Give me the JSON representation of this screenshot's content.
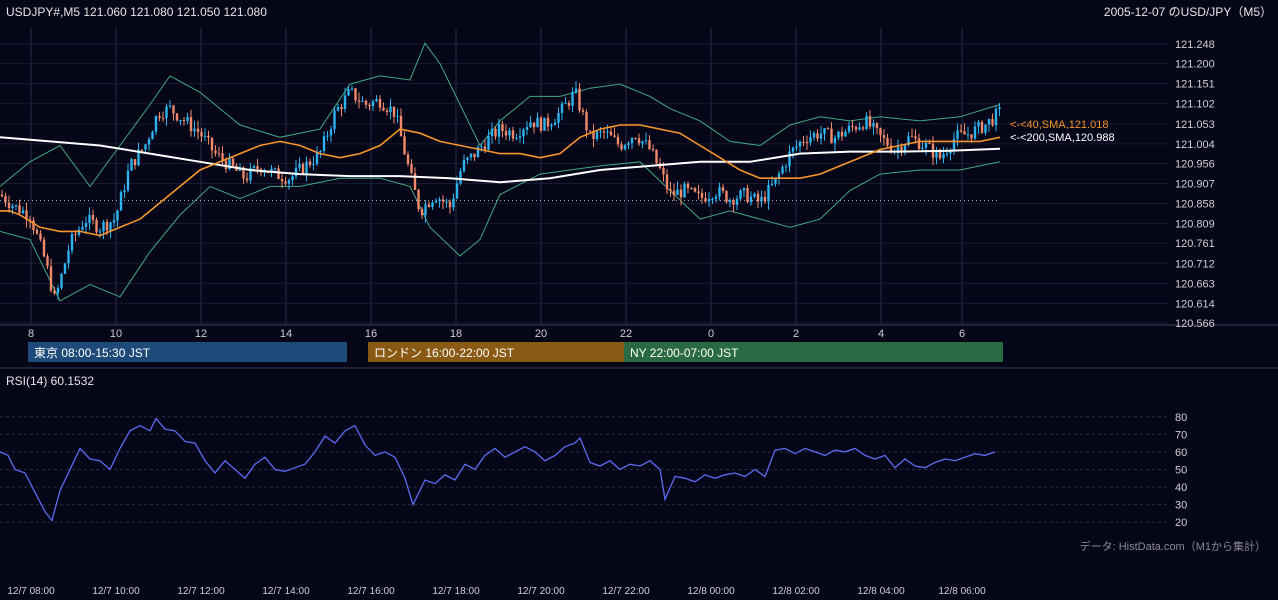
{
  "header": {
    "symbol_line": "USDJPY#,M5 121.060 121.080 121.050 121.080",
    "title": "2005-12-07 のUSD/JPY（M5）"
  },
  "chart_data": [
    {
      "type": "candlestick",
      "name": "price",
      "y_ticks": [
        "121.248",
        "121.200",
        "121.151",
        "121.102",
        "121.053",
        "121.004",
        "120.956",
        "120.907",
        "120.858",
        "120.809",
        "120.761",
        "120.712",
        "120.663",
        "120.614",
        "120.566"
      ],
      "ylim": [
        120.566,
        121.248
      ],
      "x_ticks": [
        "8",
        "10",
        "12",
        "14",
        "16",
        "18",
        "20",
        "22",
        "0",
        "2",
        "4",
        "6"
      ],
      "dotted_level": 120.865,
      "sma40": {
        "label": "<-<40,SMA,121.018",
        "value": 121.018,
        "color": "#f5962d",
        "points": [
          [
            0,
            120.84
          ],
          [
            10,
            120.84
          ],
          [
            20,
            120.83
          ],
          [
            40,
            120.8
          ],
          [
            60,
            120.79
          ],
          [
            80,
            120.79
          ],
          [
            100,
            120.78
          ],
          [
            120,
            120.8
          ],
          [
            140,
            120.82
          ],
          [
            160,
            120.86
          ],
          [
            180,
            120.9
          ],
          [
            200,
            120.94
          ],
          [
            220,
            120.96
          ],
          [
            240,
            120.98
          ],
          [
            260,
            121.0
          ],
          [
            280,
            121.01
          ],
          [
            300,
            121.0
          ],
          [
            320,
            120.98
          ],
          [
            340,
            120.97
          ],
          [
            360,
            120.98
          ],
          [
            380,
            121.0
          ],
          [
            400,
            121.04
          ],
          [
            420,
            121.03
          ],
          [
            440,
            121.01
          ],
          [
            460,
            121.0
          ],
          [
            480,
            120.99
          ],
          [
            500,
            120.98
          ],
          [
            520,
            120.98
          ],
          [
            540,
            120.97
          ],
          [
            560,
            120.98
          ],
          [
            580,
            121.02
          ],
          [
            600,
            121.04
          ],
          [
            620,
            121.05
          ],
          [
            640,
            121.05
          ],
          [
            660,
            121.04
          ],
          [
            680,
            121.03
          ],
          [
            700,
            121.0
          ],
          [
            720,
            120.97
          ],
          [
            740,
            120.94
          ],
          [
            760,
            120.92
          ],
          [
            780,
            120.92
          ],
          [
            800,
            120.92
          ],
          [
            820,
            120.93
          ],
          [
            840,
            120.95
          ],
          [
            860,
            120.97
          ],
          [
            880,
            120.99
          ],
          [
            900,
            121.0
          ],
          [
            920,
            121.01
          ],
          [
            940,
            121.01
          ],
          [
            960,
            121.01
          ],
          [
            980,
            121.01
          ],
          [
            1000,
            121.02
          ]
        ]
      },
      "sma200": {
        "label": "<-<200,SMA,120.988",
        "value": 120.988,
        "color": "#ffffff",
        "points": [
          [
            0,
            121.02
          ],
          [
            50,
            121.01
          ],
          [
            100,
            121.0
          ],
          [
            150,
            120.98
          ],
          [
            200,
            120.96
          ],
          [
            250,
            120.94
          ],
          [
            300,
            120.93
          ],
          [
            350,
            120.925
          ],
          [
            400,
            120.925
          ],
          [
            450,
            120.92
          ],
          [
            500,
            120.91
          ],
          [
            550,
            120.92
          ],
          [
            600,
            120.94
          ],
          [
            650,
            120.95
          ],
          [
            700,
            120.96
          ],
          [
            750,
            120.96
          ],
          [
            800,
            120.98
          ],
          [
            850,
            120.985
          ],
          [
            900,
            120.985
          ],
          [
            950,
            120.987
          ],
          [
            1000,
            120.992
          ]
        ]
      },
      "bollinger": {
        "color": "#4fd19a",
        "upper": [
          [
            0,
            120.9
          ],
          [
            30,
            120.96
          ],
          [
            60,
            121.0
          ],
          [
            90,
            120.9
          ],
          [
            120,
            121.0
          ],
          [
            150,
            121.1
          ],
          [
            170,
            121.17
          ],
          [
            200,
            121.13
          ],
          [
            240,
            121.05
          ],
          [
            280,
            121.02
          ],
          [
            320,
            121.04
          ],
          [
            350,
            121.15
          ],
          [
            380,
            121.17
          ],
          [
            410,
            121.16
          ],
          [
            425,
            121.25
          ],
          [
            440,
            121.2
          ],
          [
            460,
            121.1
          ],
          [
            480,
            121.0
          ],
          [
            500,
            121.06
          ],
          [
            530,
            121.12
          ],
          [
            560,
            121.12
          ],
          [
            590,
            121.14
          ],
          [
            620,
            121.15
          ],
          [
            650,
            121.12
          ],
          [
            670,
            121.09
          ],
          [
            700,
            121.06
          ],
          [
            730,
            121.01
          ],
          [
            760,
            121.0
          ],
          [
            790,
            121.05
          ],
          [
            820,
            121.07
          ],
          [
            850,
            121.06
          ],
          [
            880,
            121.07
          ],
          [
            920,
            121.06
          ],
          [
            960,
            121.07
          ],
          [
            1000,
            121.1
          ]
        ],
        "lower": [
          [
            0,
            120.79
          ],
          [
            30,
            120.77
          ],
          [
            60,
            120.62
          ],
          [
            90,
            120.66
          ],
          [
            120,
            120.63
          ],
          [
            150,
            120.74
          ],
          [
            180,
            120.83
          ],
          [
            210,
            120.9
          ],
          [
            240,
            120.87
          ],
          [
            270,
            120.9
          ],
          [
            300,
            120.9
          ],
          [
            340,
            120.92
          ],
          [
            380,
            120.92
          ],
          [
            410,
            120.9
          ],
          [
            430,
            120.8
          ],
          [
            460,
            120.73
          ],
          [
            480,
            120.77
          ],
          [
            500,
            120.88
          ],
          [
            540,
            120.93
          ],
          [
            570,
            120.94
          ],
          [
            600,
            120.95
          ],
          [
            640,
            120.96
          ],
          [
            670,
            120.89
          ],
          [
            700,
            120.82
          ],
          [
            730,
            120.84
          ],
          [
            760,
            120.82
          ],
          [
            790,
            120.8
          ],
          [
            820,
            120.82
          ],
          [
            850,
            120.89
          ],
          [
            880,
            120.93
          ],
          [
            920,
            120.94
          ],
          [
            960,
            120.94
          ],
          [
            1000,
            120.96
          ]
        ]
      },
      "close_series": [
        [
          0,
          120.88
        ],
        [
          15,
          120.85
        ],
        [
          30,
          120.83
        ],
        [
          45,
          120.72
        ],
        [
          55,
          120.62
        ],
        [
          70,
          120.76
        ],
        [
          85,
          120.82
        ],
        [
          100,
          120.8
        ],
        [
          115,
          120.82
        ],
        [
          130,
          120.95
        ],
        [
          145,
          121.0
        ],
        [
          158,
          121.08
        ],
        [
          170,
          121.09
        ],
        [
          185,
          121.06
        ],
        [
          200,
          121.03
        ],
        [
          215,
          120.98
        ],
        [
          230,
          120.95
        ],
        [
          245,
          120.92
        ],
        [
          260,
          120.95
        ],
        [
          275,
          120.93
        ],
        [
          290,
          120.92
        ],
        [
          305,
          120.95
        ],
        [
          320,
          120.98
        ],
        [
          335,
          121.08
        ],
        [
          350,
          121.13
        ],
        [
          365,
          121.1
        ],
        [
          380,
          121.11
        ],
        [
          395,
          121.08
        ],
        [
          410,
          120.93
        ],
        [
          420,
          120.84
        ],
        [
          435,
          120.88
        ],
        [
          450,
          120.85
        ],
        [
          462,
          120.95
        ],
        [
          475,
          120.98
        ],
        [
          490,
          121.02
        ],
        [
          500,
          121.04
        ],
        [
          515,
          121.03
        ],
        [
          530,
          121.06
        ],
        [
          545,
          121.05
        ],
        [
          560,
          121.08
        ],
        [
          575,
          121.13
        ],
        [
          590,
          121.02
        ],
        [
          605,
          121.03
        ],
        [
          620,
          121.0
        ],
        [
          635,
          121.03
        ],
        [
          650,
          120.99
        ],
        [
          660,
          120.94
        ],
        [
          670,
          120.88
        ],
        [
          685,
          120.89
        ],
        [
          700,
          120.87
        ],
        [
          715,
          120.89
        ],
        [
          730,
          120.87
        ],
        [
          745,
          120.88
        ],
        [
          760,
          120.86
        ],
        [
          775,
          120.91
        ],
        [
          790,
          120.98
        ],
        [
          805,
          121.02
        ],
        [
          820,
          121.03
        ],
        [
          835,
          121.02
        ],
        [
          850,
          121.04
        ],
        [
          865,
          121.06
        ],
        [
          880,
          121.02
        ],
        [
          895,
          120.99
        ],
        [
          910,
          121.02
        ],
        [
          925,
          121.0
        ],
        [
          940,
          120.97
        ],
        [
          955,
          121.02
        ],
        [
          970,
          121.03
        ],
        [
          985,
          121.05
        ],
        [
          1000,
          121.08
        ]
      ]
    },
    {
      "type": "line",
      "name": "RSI(14) 60.1532",
      "color": "#5b6cf0",
      "y_ticks": [
        "80",
        "70",
        "60",
        "50",
        "40",
        "30",
        "20"
      ],
      "ylim": [
        15,
        85
      ],
      "x_ticks": [
        "12/7 08:00",
        "12/7 10:00",
        "12/7 12:00",
        "12/7 14:00",
        "12/7 16:00",
        "12/7 18:00",
        "12/7 20:00",
        "12/7 22:00",
        "12/8 00:00",
        "12/8 02:00",
        "12/8 04:00",
        "12/8 06:00"
      ],
      "values": [
        [
          0,
          60
        ],
        [
          8,
          58
        ],
        [
          15,
          50
        ],
        [
          25,
          48
        ],
        [
          35,
          37
        ],
        [
          45,
          26
        ],
        [
          52,
          21
        ],
        [
          60,
          38
        ],
        [
          70,
          50
        ],
        [
          80,
          62
        ],
        [
          90,
          56
        ],
        [
          100,
          55
        ],
        [
          110,
          50
        ],
        [
          120,
          62
        ],
        [
          130,
          72
        ],
        [
          140,
          75
        ],
        [
          150,
          72
        ],
        [
          156,
          79
        ],
        [
          165,
          73
        ],
        [
          175,
          72
        ],
        [
          185,
          66
        ],
        [
          195,
          65
        ],
        [
          205,
          55
        ],
        [
          215,
          48
        ],
        [
          225,
          55
        ],
        [
          235,
          50
        ],
        [
          245,
          45
        ],
        [
          255,
          53
        ],
        [
          265,
          57
        ],
        [
          275,
          50
        ],
        [
          285,
          49
        ],
        [
          295,
          51
        ],
        [
          305,
          53
        ],
        [
          315,
          60
        ],
        [
          325,
          69
        ],
        [
          335,
          65
        ],
        [
          345,
          72
        ],
        [
          355,
          75
        ],
        [
          365,
          64
        ],
        [
          375,
          58
        ],
        [
          385,
          60
        ],
        [
          395,
          57
        ],
        [
          405,
          45
        ],
        [
          413,
          30
        ],
        [
          425,
          44
        ],
        [
          435,
          42
        ],
        [
          445,
          47
        ],
        [
          455,
          44
        ],
        [
          465,
          53
        ],
        [
          475,
          50
        ],
        [
          485,
          58
        ],
        [
          495,
          62
        ],
        [
          505,
          57
        ],
        [
          515,
          60
        ],
        [
          525,
          63
        ],
        [
          535,
          60
        ],
        [
          545,
          55
        ],
        [
          555,
          58
        ],
        [
          565,
          63
        ],
        [
          575,
          65
        ],
        [
          580,
          68
        ],
        [
          590,
          54
        ],
        [
          600,
          52
        ],
        [
          610,
          55
        ],
        [
          620,
          50
        ],
        [
          630,
          53
        ],
        [
          640,
          52
        ],
        [
          650,
          55
        ],
        [
          660,
          50
        ],
        [
          665,
          33
        ],
        [
          675,
          46
        ],
        [
          685,
          45
        ],
        [
          695,
          43
        ],
        [
          705,
          47
        ],
        [
          715,
          45
        ],
        [
          725,
          47
        ],
        [
          735,
          48
        ],
        [
          745,
          46
        ],
        [
          755,
          50
        ],
        [
          765,
          46
        ],
        [
          775,
          61
        ],
        [
          785,
          62
        ],
        [
          795,
          59
        ],
        [
          805,
          62
        ],
        [
          815,
          60
        ],
        [
          825,
          58
        ],
        [
          835,
          61
        ],
        [
          845,
          60
        ],
        [
          855,
          62
        ],
        [
          865,
          58
        ],
        [
          875,
          56
        ],
        [
          885,
          58
        ],
        [
          895,
          51
        ],
        [
          905,
          56
        ],
        [
          915,
          52
        ],
        [
          925,
          51
        ],
        [
          935,
          54
        ],
        [
          945,
          56
        ],
        [
          955,
          55
        ],
        [
          965,
          57
        ],
        [
          975,
          59
        ],
        [
          985,
          58
        ],
        [
          995,
          60
        ]
      ]
    }
  ],
  "sessions": [
    {
      "label": "東京 08:00-15:30 JST",
      "color": "#1e4a7a"
    },
    {
      "label": "ロンドン 16:00-22:00 JST",
      "color": "#8a5a14"
    },
    {
      "label": "NY 22:00-07:00 JST",
      "color": "#2a6a43"
    }
  ],
  "source": "データ: HistData.com（M1から集計）"
}
